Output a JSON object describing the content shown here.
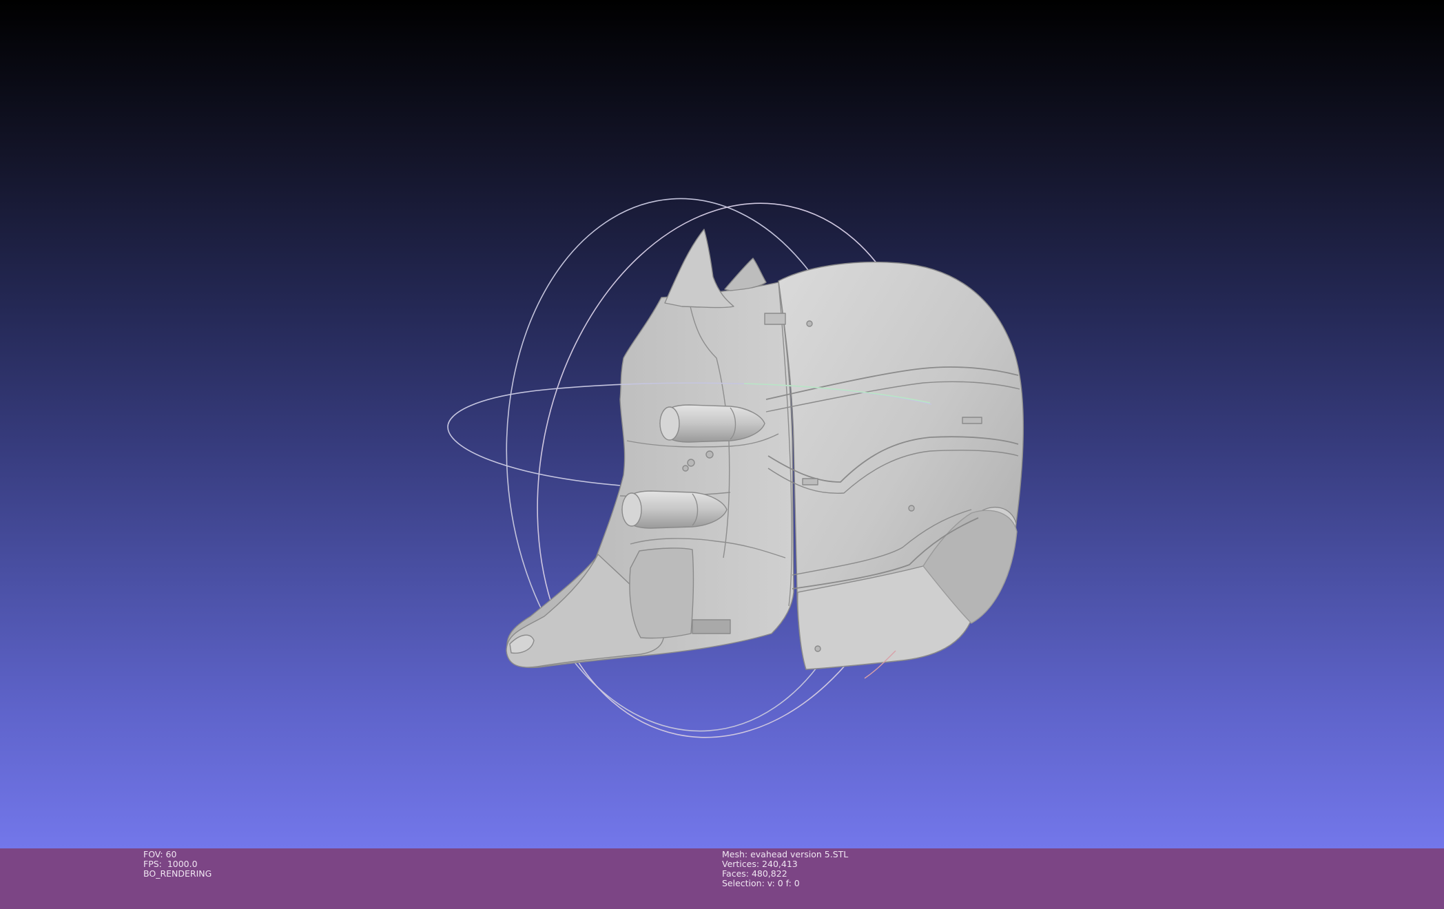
{
  "viewer": {
    "app": "MeshLab",
    "background_top": "#000000",
    "background_bottom": "#7377ea",
    "mesh_color": "#c9c9c9",
    "trackball_ring_color": "#c8c8dc",
    "trackball_horizontal_ring_color": "#b9e7c4"
  },
  "status_bar": {
    "color": "#7c4585",
    "left": {
      "fov": "FOV: 60",
      "fps": "FPS:  1000.0",
      "mode": "BO_RENDERING"
    },
    "right": {
      "mesh": "Mesh: evahead version 5.STL",
      "vertices": "Vertices: 240,413",
      "faces": "Faces: 480,822",
      "selection": "Selection: v: 0 f: 0"
    }
  }
}
